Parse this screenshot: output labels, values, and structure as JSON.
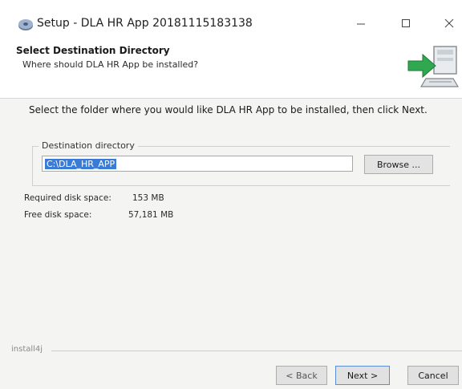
{
  "window": {
    "title": "Setup - DLA HR App 20181115183138",
    "controls": {
      "minimize": "—",
      "maximize": "☐",
      "close": "✕"
    }
  },
  "header": {
    "title": "Select Destination Directory",
    "subtitle": "Where should DLA HR App be installed?",
    "graphic_icon": "install-arrow-icon"
  },
  "main": {
    "instruction": "Select the folder where you would like DLA HR App to be installed, then click Next.",
    "destination": {
      "legend": "Destination directory",
      "value": "C:\\DLA_HR_APP",
      "browse_label": "Browse ..."
    },
    "disk": {
      "required_label": "Required disk space:",
      "required_value": "153 MB",
      "free_label": "Free disk space:",
      "free_value": "57,181 MB"
    }
  },
  "footer": {
    "brand": "install4j",
    "back_label": "< Back",
    "next_label": "Next >",
    "cancel_label": "Cancel"
  },
  "colors": {
    "accent": "#3a7bd5",
    "arrow_green": "#2fa84f"
  }
}
